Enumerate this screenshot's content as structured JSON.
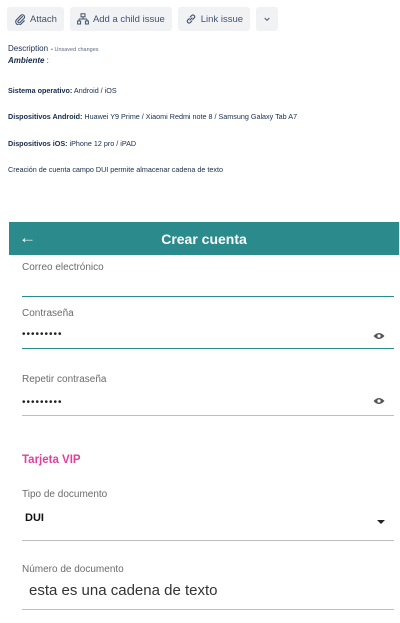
{
  "toolbar": {
    "attach": "Attach",
    "add_child": "Add a child issue",
    "link_issue": "Link issue"
  },
  "description": {
    "label": "Description",
    "unsaved": "• Unsaved changes",
    "ambiente": "Ambiente",
    "ambiente_suffix": " :",
    "so_label": "Sistema operativo:",
    "so_value": " Android / iOS",
    "android_label": "Dispositivos Android:",
    "android_value": " Huawei Y9 Prime / Xiaomi Redmi note 8 / Samsung Galaxy Tab A7",
    "ios_label": "Dispositivos iOS:",
    "ios_value": " iPhone 12 pro / iPAD",
    "summary": "Creación de cuenta  campo DUI permite almacenar cadena de texto"
  },
  "app": {
    "title": "Crear cuenta",
    "back_icon": "arrow-left",
    "fields": {
      "email_label": "Correo electrónico",
      "password_label": "Contraseña",
      "password_value": "•••••••••",
      "repeat_label": "Repetir contraseña",
      "repeat_value": "•••••••••",
      "vip_section": "Tarjeta VIP",
      "doc_type_label": "Tipo de documento",
      "doc_type_value": "DUI",
      "doc_number_label": "Número de documento",
      "doc_number_value": "esta es una cadena de texto"
    },
    "colors": {
      "appbar": "#2a8a8c",
      "section": "#e0409a"
    }
  }
}
